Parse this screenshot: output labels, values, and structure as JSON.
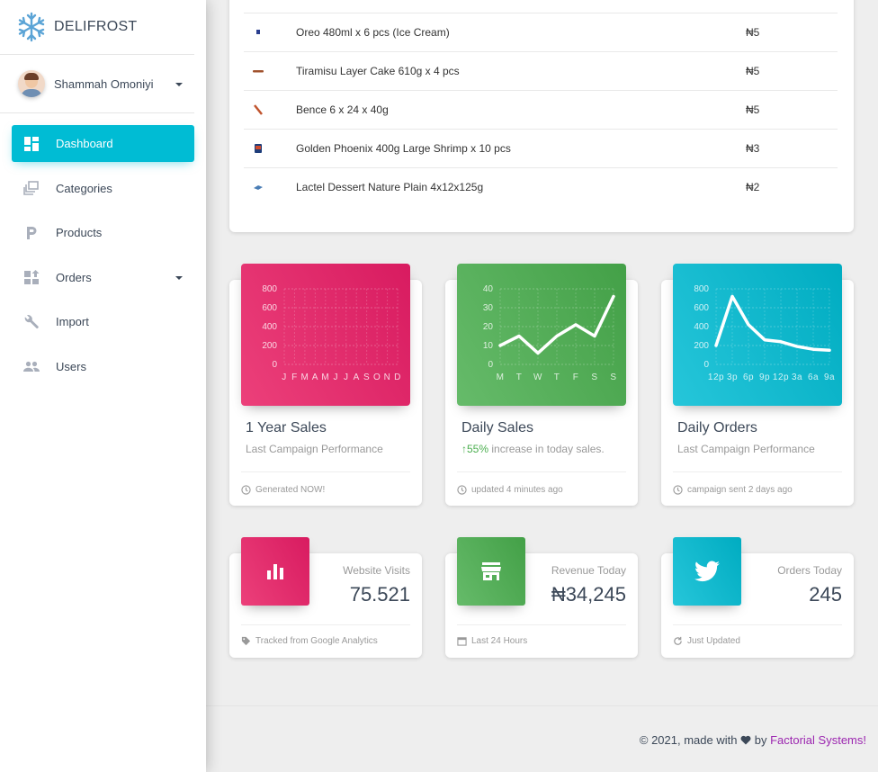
{
  "brand": {
    "name": "DELIFROST"
  },
  "user": {
    "name": "Shammah Omoniyi"
  },
  "nav": [
    {
      "label": "Dashboard",
      "icon": "dashboard-icon",
      "active": true
    },
    {
      "label": "Categories",
      "icon": "library-icon"
    },
    {
      "label": "Products",
      "icon": "letter-p-icon"
    },
    {
      "label": "Orders",
      "icon": "orders-icon",
      "has_caret": true
    },
    {
      "label": "Import",
      "icon": "wrench-icon"
    },
    {
      "label": "Users",
      "icon": "people-icon"
    }
  ],
  "products": [
    {
      "name": "Oreo 480ml x 6 pcs (Ice Cream)",
      "qty": "₦5",
      "icon": "product-thumb-icon"
    },
    {
      "name": "Tiramisu Layer Cake 610g x 4 pcs",
      "qty": "₦5",
      "icon": "product-thumb-icon"
    },
    {
      "name": "Bence 6 x 24 x 40g",
      "qty": "₦5",
      "icon": "product-thumb-icon"
    },
    {
      "name": "Golden Phoenix 400g Large Shrimp x 10 pcs",
      "qty": "₦3",
      "icon": "product-thumb-icon"
    },
    {
      "name": "Lactel Dessert Nature Plain 4x12x125g",
      "qty": "₦2",
      "icon": "product-thumb-icon"
    }
  ],
  "charts": {
    "year": {
      "title": "1 Year Sales",
      "subtitle": "Last Campaign Performance",
      "footer": "Generated NOW!"
    },
    "daily": {
      "title": "Daily Sales",
      "subtitle_pct": "55%",
      "subtitle_rest": " increase in today sales.",
      "footer": "updated 4 minutes ago"
    },
    "orders": {
      "title": "Daily Orders",
      "subtitle": "Last Campaign Performance",
      "footer": "campaign sent 2 days ago"
    }
  },
  "stats": [
    {
      "category": "Website Visits",
      "value": "75.521",
      "footer": "Tracked from Google Analytics",
      "color": "#e91e63",
      "icon": "bar-chart-icon",
      "footer_icon": "tag-icon"
    },
    {
      "category": "Revenue Today",
      "value": "₦34,245",
      "footer": "Last 24 Hours",
      "color": "#4caf50",
      "icon": "store-icon",
      "footer_icon": "calendar-icon"
    },
    {
      "category": "Orders Today",
      "value": "245",
      "footer": "Just Updated",
      "color": "#00bcd4",
      "icon": "twitter-icon",
      "footer_icon": "refresh-icon"
    }
  ],
  "footer": {
    "prefix": "© 2021, made with",
    "by": "by",
    "link": "Factorial Systems!"
  },
  "colors": {
    "accent": "#00bcd4",
    "rose": "#e91e63",
    "green": "#4caf50",
    "link": "#9c27b0"
  },
  "chart_data": [
    {
      "type": "line",
      "categories": [
        "J",
        "F",
        "M",
        "A",
        "M",
        "J",
        "J",
        "A",
        "S",
        "O",
        "N",
        "D"
      ],
      "ylim": [
        0,
        800
      ],
      "yticks": [
        "800",
        "600",
        "400",
        "200",
        "0"
      ],
      "series": [
        {
          "values": []
        }
      ],
      "color": "#e91e63"
    },
    {
      "type": "line",
      "categories": [
        "M",
        "T",
        "W",
        "T",
        "F",
        "S",
        "S"
      ],
      "ylim": [
        0,
        40
      ],
      "yticks": [
        "40",
        "30",
        "20",
        "10",
        "0"
      ],
      "series": [
        {
          "values": [
            10,
            15,
            6,
            15,
            21,
            15,
            36
          ]
        }
      ],
      "color": "#4caf50"
    },
    {
      "type": "line",
      "categories": [
        "12p",
        "3p",
        "6p",
        "9p",
        "12p",
        "3a",
        "6a",
        "9a"
      ],
      "ylim": [
        0,
        800
      ],
      "yticks": [
        "800",
        "600",
        "400",
        "200",
        "0"
      ],
      "series": [
        {
          "values": [
            200,
            720,
            420,
            260,
            240,
            190,
            160,
            150
          ]
        }
      ],
      "color": "#00bcd4"
    }
  ]
}
